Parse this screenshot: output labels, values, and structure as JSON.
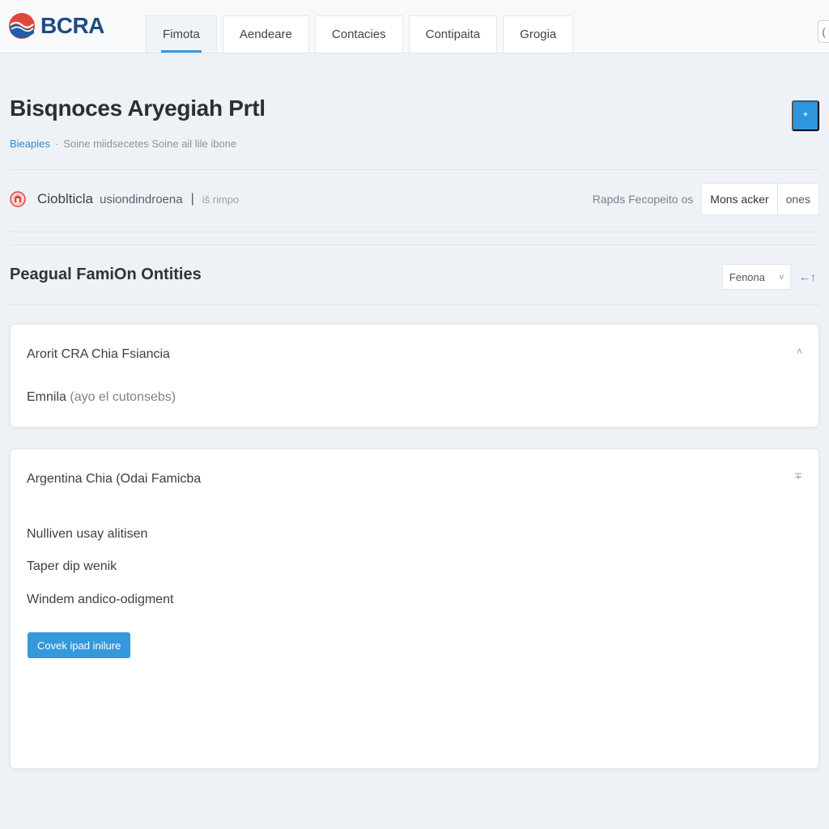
{
  "brand": {
    "name": "BCRA"
  },
  "nav": {
    "tabs": [
      {
        "label": "Fimota",
        "active": true
      },
      {
        "label": "Aendeare",
        "active": false
      },
      {
        "label": "Contacies",
        "active": false
      },
      {
        "label": "Contipaita",
        "active": false
      },
      {
        "label": "Grogia",
        "active": false
      }
    ],
    "right_icon": "("
  },
  "page": {
    "title": "Bisqnoces Aryegiah Prtl",
    "breadcrumb": [
      "Bieapies",
      "Soine miidsecetes Soine ail lile ibone"
    ],
    "action_icon": "*"
  },
  "info": {
    "name": "Cioblticla",
    "subtitle": "usiondindroena",
    "separator": "|",
    "meta": "iš rimpo",
    "meta_right": "Rapds Fecopeito os",
    "buttons": [
      "Mons acker",
      "ones"
    ]
  },
  "section": {
    "title": "Peagual FamiOn Ontities",
    "select_value": "Fenona",
    "select_caret": "v",
    "sort_label": "←↑"
  },
  "cards": [
    {
      "title": "Arorit CRA Chia Fsiancia",
      "toggle": "˄",
      "lines": [
        {
          "text": "Emnila",
          "muted": "(ayo el cutonsebs)"
        }
      ]
    },
    {
      "title": "Argentina Chia (Odai Famicba",
      "toggle": "∓",
      "lines": [
        {
          "text": "Nulliven usay alitisen",
          "muted": ""
        },
        {
          "text": "Taper dip wenik",
          "muted": ""
        },
        {
          "text": "Windem andico-odigment",
          "muted": ""
        }
      ],
      "button": "Covek ipad inilure"
    }
  ],
  "colors": {
    "accent": "#3598dc",
    "brand_blue": "#1f4a86",
    "brand_red": "#e0463a",
    "page_bg": "#eef2f6"
  },
  "icons": {
    "logo": "bcra-logo-icon",
    "info": "bank-logo-icon",
    "header_action": "asterisk-icon"
  }
}
